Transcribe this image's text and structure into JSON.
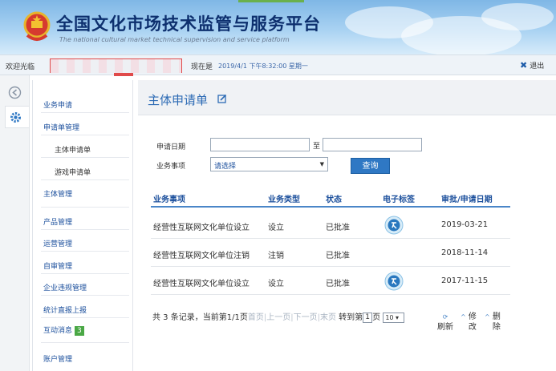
{
  "header": {
    "title_cn": "全国文化市场技术监管与服务平台",
    "title_en": "The national cultural market technical supervision and service platform"
  },
  "welcome_bar": {
    "welcome_label": "欢迎光临",
    "now_label": "现在是",
    "now_value": "2019/4/1 下午8:32:00 星期一",
    "logout_label": "退出"
  },
  "sidebar": {
    "items": [
      {
        "label": "业务申请"
      },
      {
        "label": "申请单管理"
      },
      {
        "label": "主体申请单"
      },
      {
        "label": "游戏申请单"
      },
      {
        "label": "主体管理"
      },
      {
        "label": "产品管理"
      },
      {
        "label": "运营管理"
      },
      {
        "label": "自审管理"
      },
      {
        "label": "企业违规管理"
      },
      {
        "label": "统计直报上报"
      },
      {
        "label": "互动消息"
      },
      {
        "label": "账户管理"
      }
    ],
    "message_badge": "3"
  },
  "main": {
    "title": "主体申请单",
    "filter": {
      "date_label": "申请日期",
      "date_to": "至",
      "type_label": "业务事项",
      "type_value": "请选择",
      "query_button": "查询"
    },
    "table": {
      "columns": [
        "业务事项",
        "业务类型",
        "状态",
        "电子标签",
        "审批/申请日期"
      ],
      "rows": [
        {
          "item": "经营性互联网文化单位设立",
          "type": "设立",
          "status": "已批准",
          "tag": true,
          "date": "2019-03-21"
        },
        {
          "item": "经营性互联网文化单位注销",
          "type": "注销",
          "status": "已批准",
          "tag": false,
          "date": "2018-11-14"
        },
        {
          "item": "经营性互联网文化单位设立",
          "type": "设立",
          "status": "已批准",
          "tag": true,
          "date": "2017-11-15"
        }
      ]
    },
    "pager": {
      "summary": "共 3 条记录，当前第1/1页",
      "first": "首页",
      "prev": "上一页",
      "next": "下一页",
      "last": "末页",
      "goto_prefix": "转到第",
      "goto_page": "1",
      "goto_suffix": "页",
      "page_size": "10",
      "refresh": "刷新",
      "edit": "修改",
      "delete": "删除"
    }
  },
  "colors": {
    "accent": "#2f78c4",
    "link": "#1b4f9c",
    "badge": "#4aa845"
  }
}
